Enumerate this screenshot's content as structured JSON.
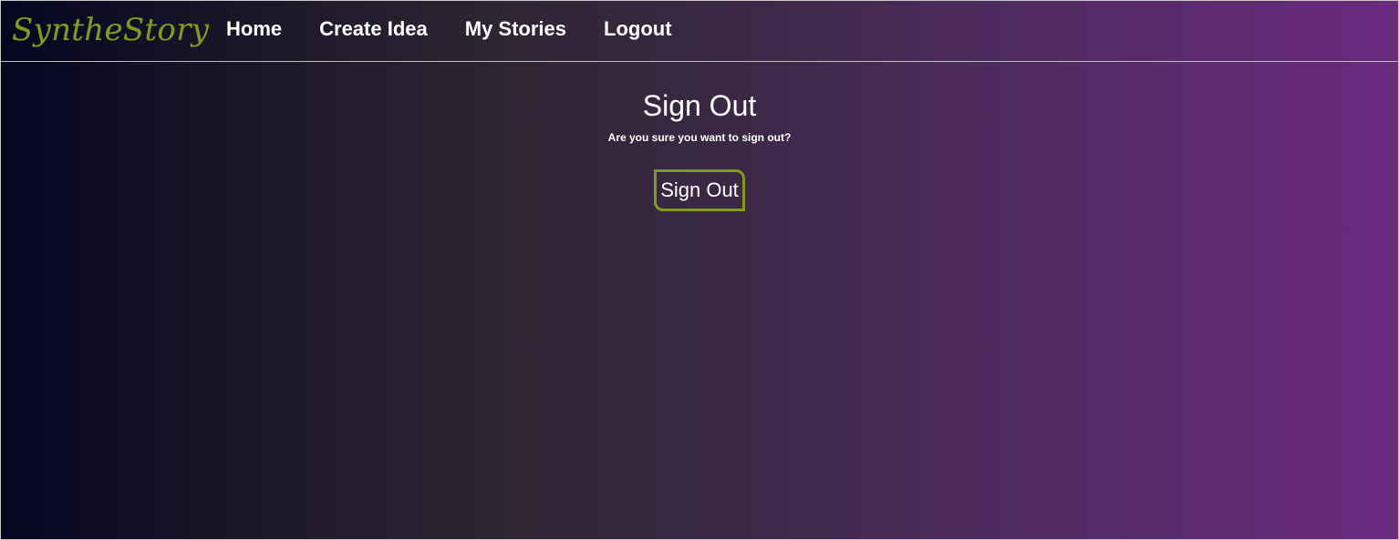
{
  "navbar": {
    "brand": "SyntheStory",
    "links": [
      {
        "label": "Home"
      },
      {
        "label": "Create Idea"
      },
      {
        "label": "My Stories"
      },
      {
        "label": "Logout"
      }
    ]
  },
  "main": {
    "title": "Sign Out",
    "subtitle": "Are you sure you want to sign out?",
    "button_label": "Sign Out"
  },
  "colors": {
    "accent": "#7f9a1f",
    "gradient_start": "#060621",
    "gradient_end": "#6b2a7f",
    "text": "#ffffff"
  }
}
